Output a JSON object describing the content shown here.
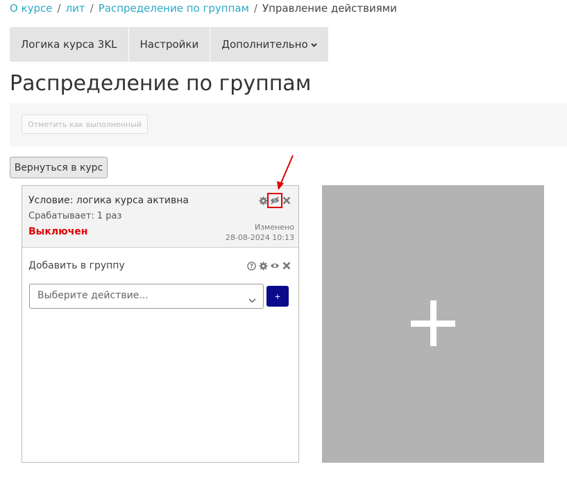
{
  "breadcrumb": [
    {
      "label": "О курсе",
      "link": true
    },
    {
      "label": "лит",
      "link": true
    },
    {
      "label": "Распределение по группам",
      "link": true
    },
    {
      "label": "Управление действиями",
      "link": false
    }
  ],
  "breadcrumb_separator": "/",
  "tabs": [
    {
      "label": "Логика курса 3KL"
    },
    {
      "label": "Настройки"
    },
    {
      "label": "Дополнительно"
    }
  ],
  "page_title": "Распределение по группам",
  "mark_done_label": "Отметить как выполненный",
  "back_button_label": "Вернуться в курс",
  "condition": {
    "title": "Условие: логика курса активна",
    "fires": "Срабатывает: 1 раз",
    "status": "Выключен",
    "modified_label": "Изменено",
    "modified_date": "28-08-2024 10:13",
    "icons": [
      "gear-icon",
      "eye-slash-icon",
      "close-icon"
    ]
  },
  "action": {
    "title": "Добавить в группу",
    "select_placeholder": "Выберите действие...",
    "add_button_label": "+",
    "icons": [
      "help-icon",
      "gear-icon",
      "eye-icon",
      "close-icon"
    ]
  },
  "colors": {
    "link": "#2aa8c9",
    "status_off": "#e00000",
    "add_button": "#0a0a8a",
    "placeholder_panel": "#b3b3b3",
    "annotation": "#e00000"
  }
}
